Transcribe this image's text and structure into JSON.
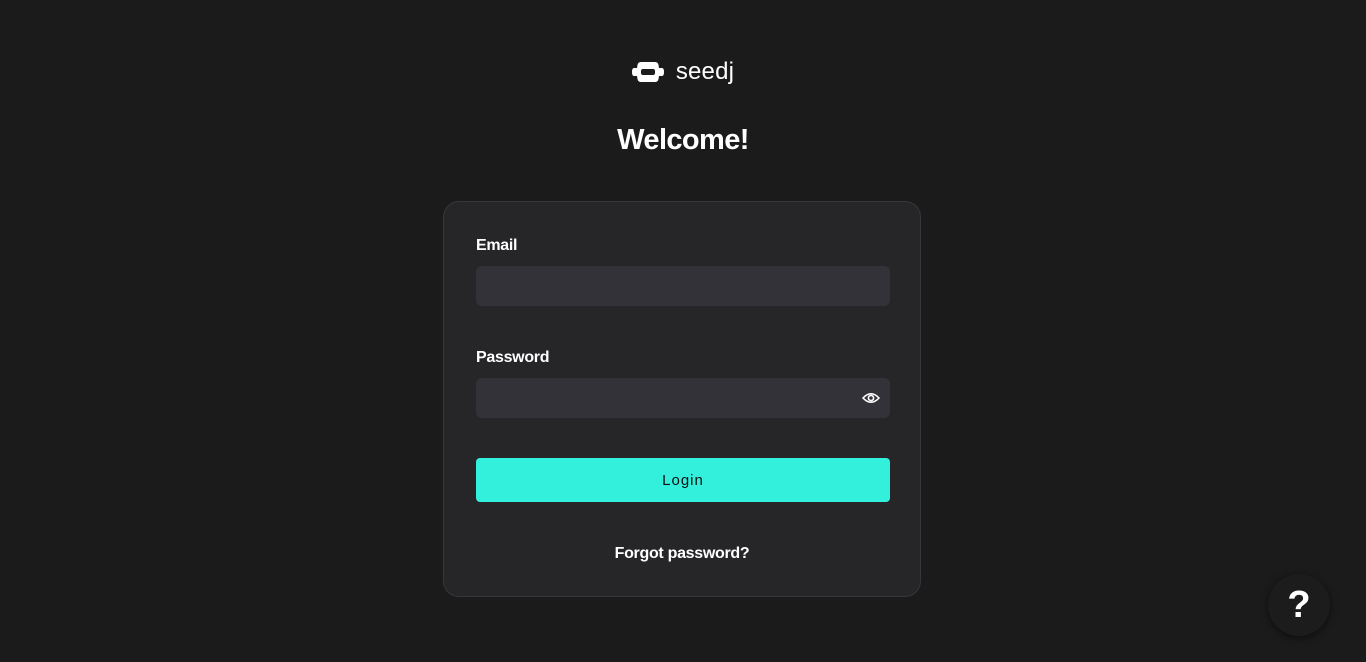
{
  "brand": {
    "logo_icon": "seedj-logo-icon",
    "name": "seedj"
  },
  "heading": "Welcome!",
  "form": {
    "email_label": "Email",
    "email_value": "",
    "password_label": "Password",
    "password_value": "",
    "password_toggle_icon": "eye-icon",
    "login_label": "Login",
    "forgot_label": "Forgot password?"
  },
  "help": {
    "icon": "question-mark-icon",
    "label": "?"
  },
  "colors": {
    "background": "#1b1b1b",
    "card": "#262629",
    "input": "#323238",
    "accent": "#33f0dc"
  }
}
